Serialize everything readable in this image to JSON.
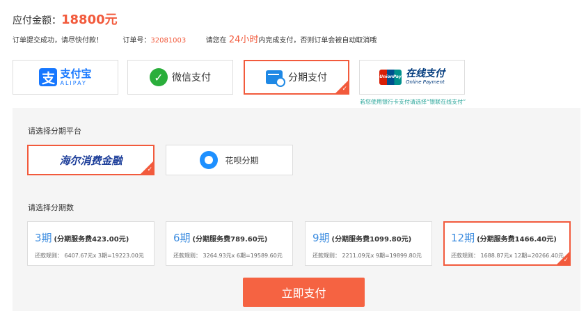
{
  "header": {
    "amount_label": "应付金额：",
    "amount_value": "18800元"
  },
  "info": {
    "submit_msg": "订单提交成功，请尽快付款！",
    "order_label": "订单号：",
    "order_no": "32081003",
    "deadline_pre": "请您在",
    "deadline_hours": "24小时",
    "deadline_post": "内完成支付，否则订单会被自动取消哦"
  },
  "pay_methods": {
    "alipay_cn": "支付宝",
    "alipay_en": "ALIPAY",
    "wechat": "微信支付",
    "installment": "分期支付",
    "unionpay_badge": "UnionPay 银联",
    "unionpay_cn": "在线支付",
    "unionpay_en": "Online Payment",
    "unionpay_tip": "若您使用银行卡支付请选择“银联在线支付”"
  },
  "platform": {
    "title": "请选择分期平台",
    "haier": "海尔消费金融",
    "huabei": "花呗分期"
  },
  "terms": {
    "title": "请选择分期数",
    "items": [
      {
        "num": "3期",
        "fee": "(分期服务费423.00元)",
        "rule": "还款规则：  6407.67元x 3期=19223.00元"
      },
      {
        "num": "6期",
        "fee": "(分期服务费789.60元)",
        "rule": "还款规则：  3264.93元x 6期=19589.60元"
      },
      {
        "num": "9期",
        "fee": "(分期服务费1099.80元)",
        "rule": "还款规则：  2211.09元x 9期=19899.80元"
      },
      {
        "num": "12期",
        "fee": "(分期服务费1466.40元)",
        "rule": "还款规则：  1688.87元x 12期=20266.40元"
      }
    ]
  },
  "action": {
    "pay_now": "立即支付"
  },
  "colors": {
    "accent": "#f25a3c",
    "link_blue": "#3f8ee0"
  }
}
